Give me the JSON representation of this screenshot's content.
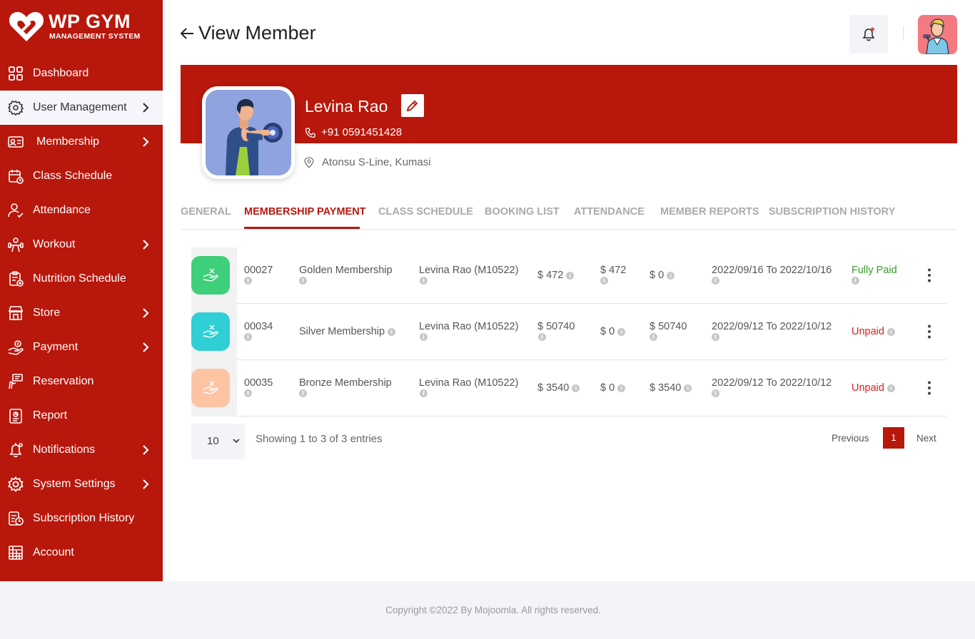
{
  "brand": {
    "title": "WP GYM",
    "subtitle": "MANAGEMENT SYSTEM"
  },
  "sidebar": {
    "items": [
      {
        "label": "Dashboard",
        "icon": "grid-icon",
        "submenu": false
      },
      {
        "label": "User Management",
        "icon": "users-gear-icon",
        "submenu": true,
        "active": true
      },
      {
        "label": "Membership",
        "icon": "id-card-icon",
        "submenu": true
      },
      {
        "label": "Class Schedule",
        "icon": "calendar-icon",
        "submenu": false
      },
      {
        "label": "Attendance",
        "icon": "user-check-icon",
        "submenu": false
      },
      {
        "label": "Workout",
        "icon": "dumbbell-icon",
        "submenu": true
      },
      {
        "label": "Nutrition Schedule",
        "icon": "clipboard-icon",
        "submenu": false
      },
      {
        "label": "Store",
        "icon": "store-icon",
        "submenu": true
      },
      {
        "label": "Payment",
        "icon": "hand-money-icon",
        "submenu": true
      },
      {
        "label": "Reservation",
        "icon": "reservation-icon",
        "submenu": false
      },
      {
        "label": "Report",
        "icon": "report-icon",
        "submenu": false
      },
      {
        "label": "Notifications",
        "icon": "bell-icon",
        "submenu": true
      },
      {
        "label": "System Settings",
        "icon": "gear-icon",
        "submenu": true
      },
      {
        "label": "Subscription History",
        "icon": "history-icon",
        "submenu": false
      },
      {
        "label": "Account",
        "icon": "account-icon",
        "submenu": false
      }
    ]
  },
  "header": {
    "title": "View Member",
    "notification_dot_color": "#e8443a"
  },
  "member": {
    "name": "Levina Rao",
    "phone": "+91  0591451428",
    "address": "Atonsu S-Line, Kumasi"
  },
  "tabs": [
    {
      "label": "GENERAL",
      "active": false
    },
    {
      "label": "MEMBERSHIP PAYMENT",
      "active": true
    },
    {
      "label": "CLASS SCHEDULE",
      "active": false
    },
    {
      "label": "BOOKING LIST",
      "active": false
    },
    {
      "label": "ATTENDANCE",
      "active": false
    },
    {
      "label": "MEMBER REPORTS",
      "active": false
    },
    {
      "label": "SUBSCRIPTION HISTORY",
      "active": false
    }
  ],
  "payments": [
    {
      "id": "00027",
      "membership": "Golden Membership",
      "member": "Levina Rao (M10522)",
      "amount": "$ 472",
      "paid": "$ 472",
      "due": "$ 0",
      "period": "2022/09/16 To 2022/10/16",
      "status": "Fully Paid",
      "badge_color": "#3ecf7a"
    },
    {
      "id": "00034",
      "membership": "Silver Membership",
      "member": "Levina Rao (M10522)",
      "amount": "$ 50740",
      "paid": "$ 0",
      "due": "$ 50740",
      "period": "2022/09/12 To 2022/10/12",
      "status": "Unpaid",
      "badge_color": "#2fcfd5"
    },
    {
      "id": "00035",
      "membership": "Bronze Membership",
      "member": "Levina Rao (M10522)",
      "amount": "$ 3540",
      "paid": "$ 0",
      "due": "$ 3540",
      "period": "2022/09/12 To 2022/10/12",
      "status": "Unpaid",
      "badge_color": "#fdc4a4"
    }
  ],
  "table_footer": {
    "page_size": "10",
    "entries_text": "Showing 1 to 3 of 3 entries",
    "previous": "Previous",
    "current_page": "1",
    "next": "Next"
  },
  "footer": {
    "copyright": "Copyright ©2022 By Mojoomla. All rights reserved."
  },
  "colors": {
    "primary": "#b8170c",
    "paid": "#3a9a2e",
    "unpaid": "#e21b1b"
  }
}
